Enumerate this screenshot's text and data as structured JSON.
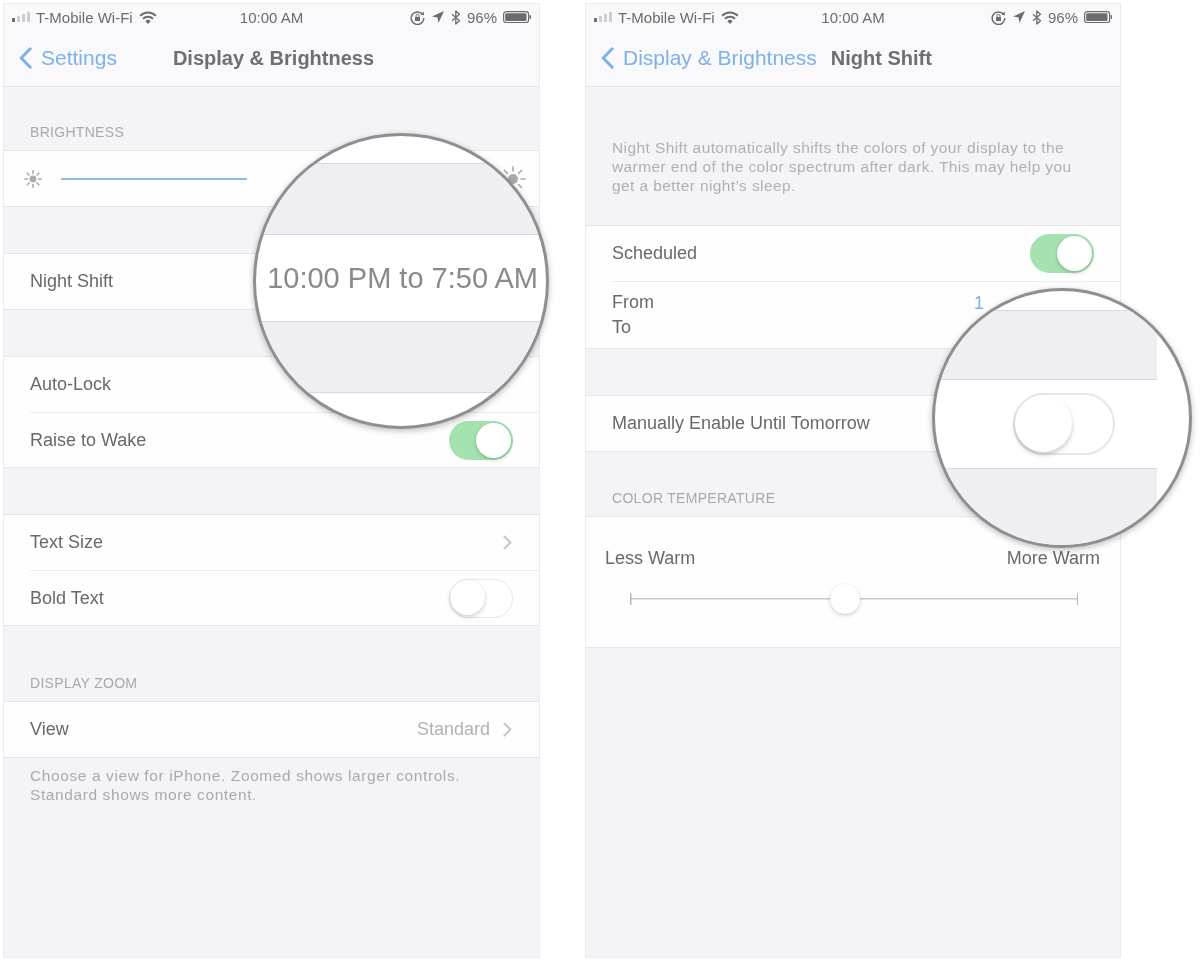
{
  "screens": [
    {
      "status_bar": {
        "carrier": "T-Mobile Wi-Fi",
        "time": "10:00 AM",
        "battery": "96%"
      },
      "nav": {
        "back": "Settings",
        "title": "Display & Brightness"
      },
      "groups": [
        {
          "header": "BRIGHTNESS",
          "rows": [
            {
              "kind": "brightness",
              "level": 1
            }
          ]
        },
        {
          "rows": [
            {
              "kind": "link",
              "label": "Night Shift"
            }
          ]
        },
        {
          "rows": [
            {
              "kind": "link",
              "label": "Auto-Lock"
            },
            {
              "kind": "toggle",
              "label": "Raise to Wake",
              "on": true
            }
          ]
        },
        {
          "rows": [
            {
              "kind": "disclosure",
              "label": "Text Size"
            },
            {
              "kind": "toggle",
              "label": "Bold Text",
              "on": false
            }
          ]
        },
        {
          "header": "DISPLAY ZOOM",
          "rows": [
            {
              "kind": "disclosure",
              "label": "View",
              "value": "Standard"
            }
          ],
          "footer": "Choose a view for iPhone. Zoomed shows larger controls. Standard shows more content."
        }
      ],
      "magnifier": {
        "kind": "text",
        "text": "10:00 PM to 7:50 AM"
      }
    },
    {
      "status_bar": {
        "carrier": "T-Mobile Wi-Fi",
        "time": "10:00 AM",
        "battery": "96%"
      },
      "nav": {
        "back": "Display & Brightness",
        "title": "Night Shift"
      },
      "groups": [
        {
          "note": "Night Shift automatically shifts the colors of your display to the warmer end of the color spectrum after dark. This may help you get a better night’s sleep.",
          "rows": [
            {
              "kind": "toggle",
              "label": "Scheduled",
              "on": true
            },
            {
              "kind": "schedule",
              "from": "From",
              "to": "To",
              "value": "1"
            }
          ]
        },
        {
          "rows": [
            {
              "kind": "link",
              "label": "Manually Enable Until Tomorrow"
            }
          ]
        },
        {
          "header": "COLOR TEMPERATURE",
          "rows": [
            {
              "kind": "temperature",
              "min_label": "Less Warm",
              "max_label": "More Warm",
              "level": 0.48
            }
          ]
        }
      ],
      "magnifier": {
        "kind": "toggle",
        "on": false
      }
    }
  ]
}
